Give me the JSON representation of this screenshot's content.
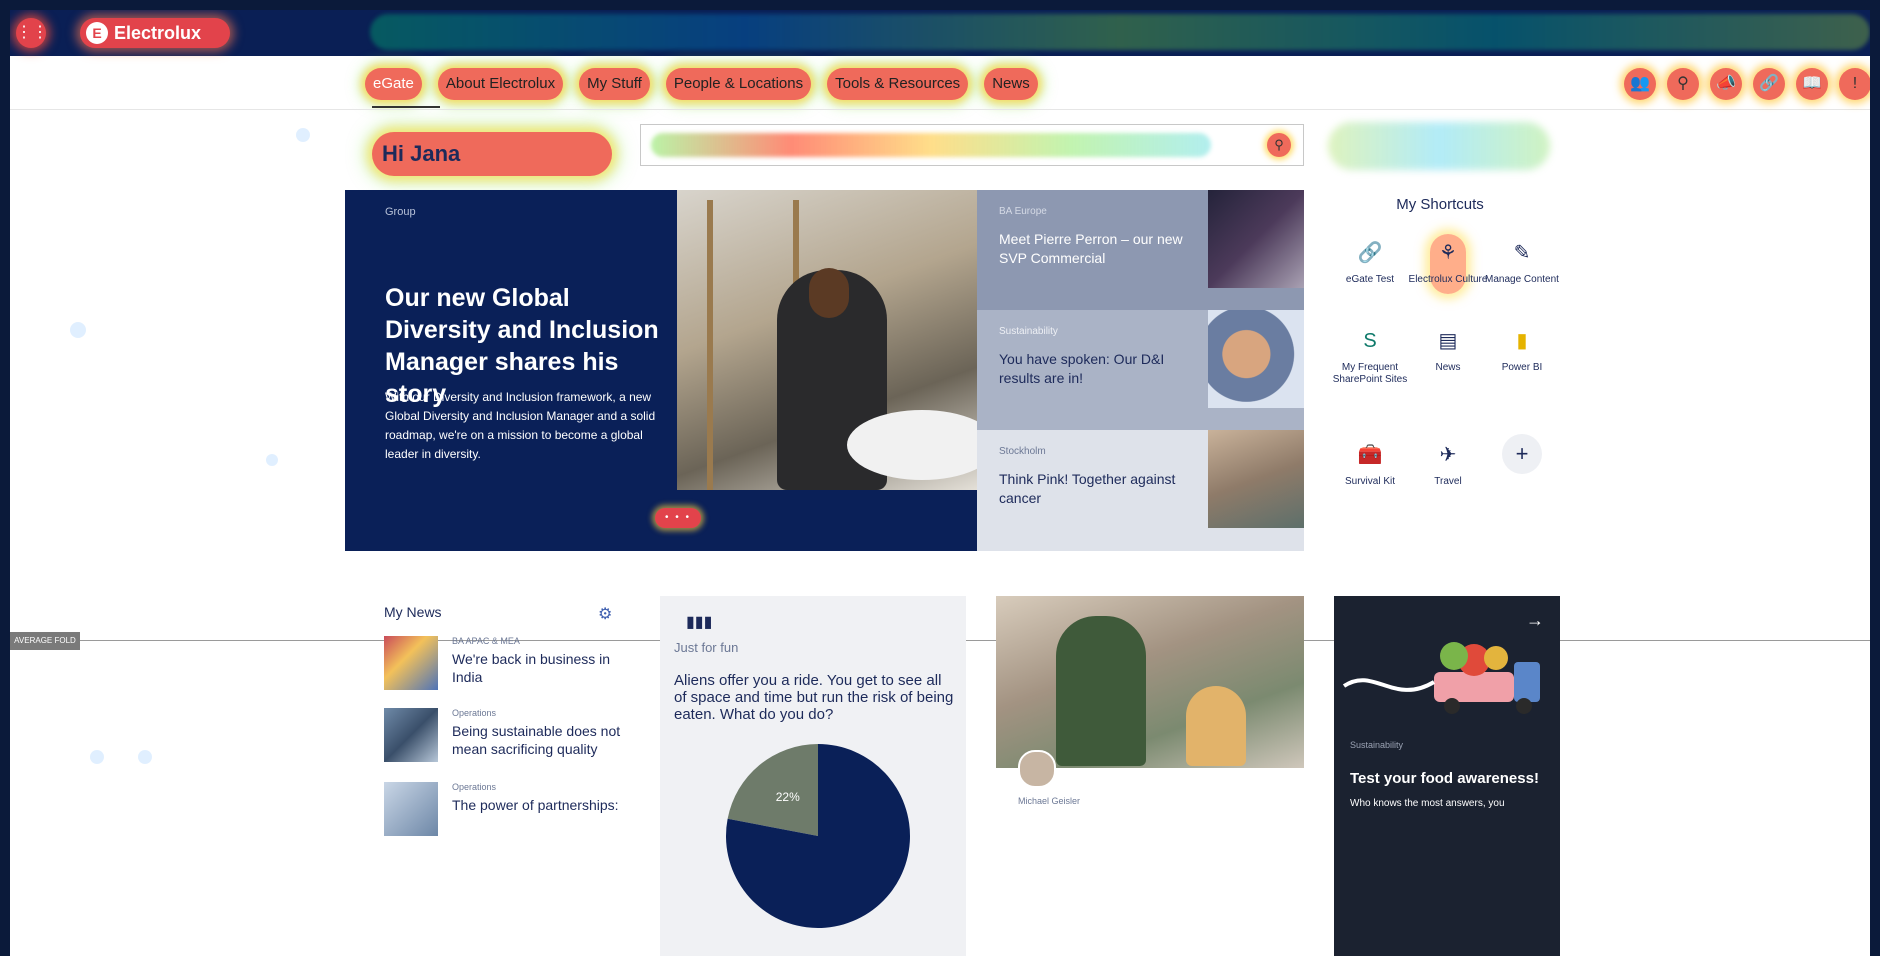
{
  "topbar": {
    "app_grid_icon": "grid-icon",
    "logo_text": "Electrolux"
  },
  "nav": {
    "tabs": [
      "eGate",
      "About Electrolux",
      "My Stuff",
      "People & Locations",
      "Tools & Resources",
      "News"
    ],
    "icons": [
      "people-icon",
      "search-icon",
      "megaphone-icon",
      "link-icon",
      "book-icon",
      "alert-icon"
    ]
  },
  "greeting": {
    "text": "Hi Jana"
  },
  "search": {
    "placeholder": "",
    "button_icon": "search-icon"
  },
  "hero": {
    "category": "Group",
    "title": "Our new Global Diversity and Inclusion Manager shares his story",
    "body": "With our Diversity and Inclusion framework, a new Global Diversity and Inclusion Manager and a solid roadmap, we're on a mission to become a global leader in diversity.",
    "dots": "• • •"
  },
  "side_stories": [
    {
      "category": "BA Europe",
      "headline": "Meet Pierre Perron – our new SVP Commercial"
    },
    {
      "category": "Sustainability",
      "headline": "You have spoken: Our D&I results are in!"
    },
    {
      "category": "Stockholm",
      "headline": "Think Pink! Together against cancer"
    }
  ],
  "shortcuts": {
    "title": "My Shortcuts",
    "items": [
      {
        "label": "eGate Test",
        "icon": "link-icon"
      },
      {
        "label": "Electrolux Culture",
        "icon": "culture-icon"
      },
      {
        "label": "Manage Content",
        "icon": "pencil-icon"
      },
      {
        "label": "My Frequent SharePoint Sites",
        "icon": "sharepoint-icon"
      },
      {
        "label": "News",
        "icon": "news-icon"
      },
      {
        "label": "Power BI",
        "icon": "powerbi-icon"
      },
      {
        "label": "Survival Kit",
        "icon": "kit-icon"
      },
      {
        "label": "Travel",
        "icon": "plane-icon"
      },
      {
        "label": "",
        "icon": "plus-icon"
      }
    ]
  },
  "fold": {
    "label": "AVERAGE FOLD"
  },
  "my_news": {
    "title": "My News",
    "items": [
      {
        "category": "BA APAC & MEA",
        "title": "We're back in business in India"
      },
      {
        "category": "Operations",
        "title": "Being sustainable does not mean sacrificing quality"
      },
      {
        "category": "Operations",
        "title": "The power of partnerships:"
      }
    ]
  },
  "poll": {
    "category": "Just for fun",
    "question": "Aliens offer you a ride. You get to see all of space and time but run the risk of being eaten. What do you do?",
    "slice_label": "22%"
  },
  "story3": {
    "author": "Michael Geisler"
  },
  "story4": {
    "category": "Sustainability",
    "title": "Test your food awareness!",
    "desc": "Who knows the most answers, you"
  },
  "chart_data": {
    "type": "pie",
    "values": [
      22,
      78
    ],
    "labels": [
      "22%",
      ""
    ]
  }
}
